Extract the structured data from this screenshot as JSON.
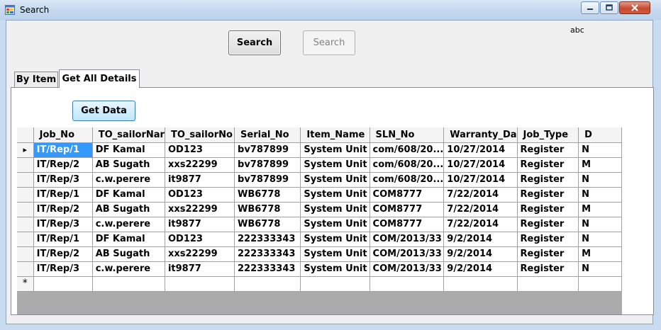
{
  "window": {
    "title": "Search"
  },
  "toolbar": {
    "search_label": "Search",
    "search_disabled_label": "Search",
    "abc_label": "abc"
  },
  "tabs": [
    {
      "label": "By Item"
    },
    {
      "label": "Get All Details"
    }
  ],
  "panel": {
    "get_data_label": "Get Data"
  },
  "grid": {
    "columns": [
      "Job_No",
      "TO_sailorNar",
      "TO_sailorNo",
      "Serial_No",
      "Item_Name",
      "SLN_No",
      "Warranty_Da",
      "Job_Type",
      "D"
    ],
    "rows": [
      [
        "IT/Rep/1",
        "DF Kamal",
        "OD123",
        "bv787899",
        "System Unit",
        "com/608/20...",
        "10/27/2014",
        "Register",
        "N"
      ],
      [
        "IT/Rep/2",
        "AB Sugath",
        "xxs22299",
        "bv787899",
        "System Unit",
        "com/608/20...",
        "10/27/2014",
        "Register",
        "M"
      ],
      [
        "IT/Rep/3",
        "c.w.perere",
        "it9877",
        "bv787899",
        "System Unit",
        "com/608/20...",
        "10/27/2014",
        "Register",
        "N"
      ],
      [
        "IT/Rep/1",
        "DF Kamal",
        "OD123",
        "WB6778",
        "System Unit",
        "COM8777",
        "7/22/2014",
        "Register",
        "N"
      ],
      [
        "IT/Rep/2",
        "AB Sugath",
        "xxs22299",
        "WB6778",
        "System Unit",
        "COM8777",
        "7/22/2014",
        "Register",
        "M"
      ],
      [
        "IT/Rep/3",
        "c.w.perere",
        "it9877",
        "WB6778",
        "System Unit",
        "COM8777",
        "7/22/2014",
        "Register",
        "N"
      ],
      [
        "IT/Rep/1",
        "DF Kamal",
        "OD123",
        "222333343",
        "System Unit",
        "COM/2013/33",
        "9/2/2014",
        "Register",
        "N"
      ],
      [
        "IT/Rep/2",
        "AB Sugath",
        "xxs22299",
        "222333343",
        "System Unit",
        "COM/2013/33",
        "9/2/2014",
        "Register",
        "M"
      ],
      [
        "IT/Rep/3",
        "c.w.perere",
        "it9877",
        "222333343",
        "System Unit",
        "COM/2013/33",
        "9/2/2014",
        "Register",
        "N"
      ]
    ],
    "current_row_glyph": "▸",
    "new_row_glyph": "*",
    "selection_color": "#3399ff"
  }
}
